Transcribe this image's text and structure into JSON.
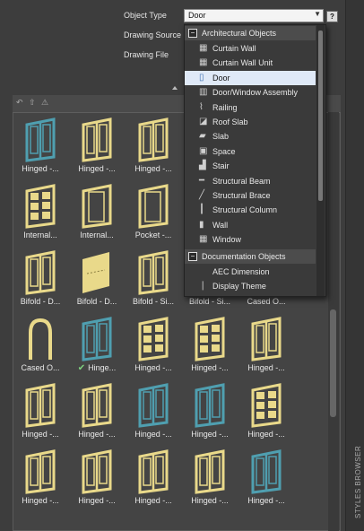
{
  "form": {
    "object_type_label": "Object Type",
    "object_type_value": "Door",
    "drawing_source_label": "Drawing Source",
    "drawing_file_label": "Drawing File",
    "help_label": "?"
  },
  "dropdown": {
    "groups": [
      {
        "name": "Architectural Objects",
        "toggle": "−"
      },
      {
        "name": "Documentation Objects",
        "toggle": "−"
      }
    ],
    "arch_items": [
      "Curtain Wall",
      "Curtain Wall Unit",
      "Door",
      "Door/Window Assembly",
      "Railing",
      "Roof Slab",
      "Slab",
      "Space",
      "Stair",
      "Structural Beam",
      "Structural Brace",
      "Structural Column",
      "Wall",
      "Window"
    ],
    "doc_items": [
      "AEC Dimension",
      "Display Theme"
    ],
    "selected": "Door"
  },
  "styles": {
    "rows": [
      [
        "Hinged -...",
        "Hinged -...",
        "Hinged -..."
      ],
      [
        "Internal...",
        "Internal...",
        "Pocket -..."
      ],
      [
        "Bifold - D...",
        "Bifold - D...",
        "Bifold - Si...",
        "Bifold - Si...",
        "Cased O..."
      ],
      [
        "Cased O...",
        "Hinge...",
        "Hinged -...",
        "Hinged -...",
        "Hinged -..."
      ],
      [
        "Hinged -...",
        "Hinged -...",
        "Hinged -...",
        "Hinged -...",
        "Hinged -..."
      ],
      [
        "Hinged -...",
        "Hinged -...",
        "Hinged -...",
        "Hinged -...",
        "Hinged -..."
      ]
    ],
    "checkmark": "✔"
  },
  "side_panel": {
    "title": "STYLES BROWSER"
  },
  "colors": {
    "door_yellow": "#e9d98a",
    "door_teal": "#4f9fb0"
  }
}
